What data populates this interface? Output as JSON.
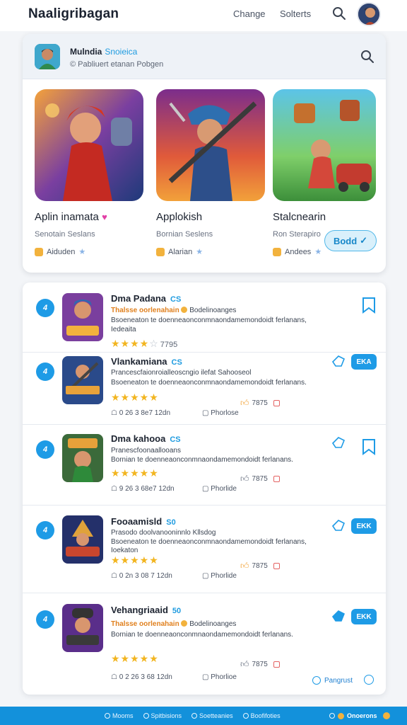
{
  "header": {
    "app_title": "Naaligribagan",
    "links": [
      "Change",
      "Solterts"
    ],
    "search_icon": "search-icon",
    "avatar": "user-avatar"
  },
  "featured": {
    "profile_name": "Mulndia",
    "profile_tag": "Snoieica",
    "profile_sub": "© Pabliuert etanan Pobgen",
    "games": [
      {
        "name": "Aplin inamata",
        "dev": "Senotain Seslans",
        "meta": "Aiduden"
      },
      {
        "name": "Applokish",
        "dev": "Bornian Seslens",
        "meta": "Alarian"
      },
      {
        "name": "Stalcnearin",
        "dev": "Ron Sterapiro",
        "meta": "Andees"
      }
    ],
    "button_label": "Bodd"
  },
  "list": [
    {
      "rank": "4",
      "title": "Dma Padana",
      "tag": "CS",
      "sub_highlight": "Thalsse oorlenahain",
      "sub_rest": "Bodelinoanges",
      "desc1": "Bsoeneaton te doenneaonconmnaondamemondoidt ferlanans,",
      "desc2": "Iedeaita",
      "rating_text": "7795",
      "stars": 4
    },
    {
      "rank": "4",
      "title": "Vlankamiana",
      "tag": "CS",
      "sub_plain": "Prancescfaionroialleoscngio ilefat Sahooseol",
      "desc1": "Bsoeneaton te doenneaonconmnaondamemondoidt ferlanans.",
      "meta_date": "0 26 3 8e7 12dn",
      "meta_extra": "Phorlose",
      "rating_text": "7875",
      "button": "EKA",
      "stars": 5
    },
    {
      "rank": "4",
      "title": "Dma kahooa",
      "tag": "CS",
      "sub_plain": "Pranescfoonaallooans",
      "desc1": "Bornian te doenneaonconmnaondamemondoidt ferlanans.",
      "meta_date": "9 26 3 68e7 12dn",
      "meta_extra": "Phorlide",
      "rating_text": "7875",
      "stars": 5
    },
    {
      "rank": "4",
      "title": "Fooaamisld",
      "tag": "S0",
      "sub_plain": "Prasodo doolvanooninnlo Kllsdog",
      "desc1": "Bsoeneaton te doenneaonconmnaondamemondoidt ferlanans,",
      "desc2": "Ioekaton",
      "meta_date": "0 2n 3 08 7 12dn",
      "meta_extra": "Phorlide",
      "rating_text": "7875",
      "button": "EKK",
      "stars": 5
    },
    {
      "rank": "4",
      "title": "Vehangriaaid",
      "tag": "50",
      "sub_highlight": "Thalsse oorlenahain",
      "sub_rest": "Bodelinoanges",
      "desc1": "Bornian te doenneaonconmnaondamemondoidt ferlanans.",
      "meta_date": "0 2 26 3 68 12dn",
      "meta_extra": "Phorlioe",
      "rating_text": "7875",
      "button": "EKK",
      "progress_label": "Pangrust",
      "stars": 5
    }
  ],
  "bottom_bar": {
    "items": [
      "Mooms",
      "Spitbisions",
      "Soetteanies",
      "Boofifoties"
    ],
    "right_label": "Onoerons"
  },
  "colors": {
    "accent": "#1e9be6",
    "star": "#f2b520",
    "bottom_bar": "#1391db"
  }
}
